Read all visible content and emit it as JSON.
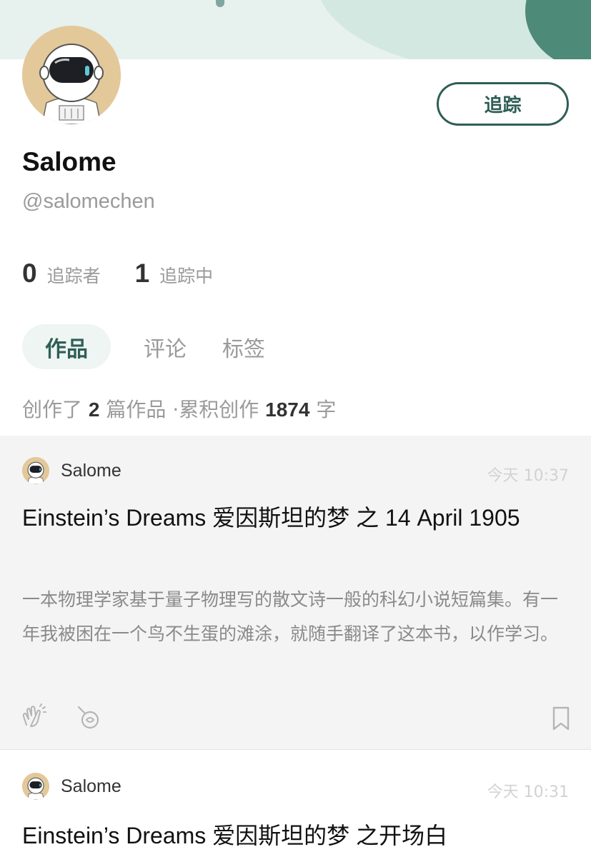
{
  "profile": {
    "follow_label": "追踪",
    "name": "Salome",
    "handle": "@salomechen",
    "followers_count": "0",
    "followers_label": "追踪者",
    "following_count": "1",
    "following_label": "追踪中",
    "avatar_icon": "astronaut-avatar"
  },
  "tabs": [
    {
      "label": "作品",
      "active": true
    },
    {
      "label": "评论",
      "active": false
    },
    {
      "label": "标签",
      "active": false
    }
  ],
  "summary": {
    "prefix": "创作了",
    "works_count": "2",
    "works_unit": "篇作品",
    "separator": "·",
    "total_label": "累积创作",
    "chars_count": "1874",
    "chars_unit": "字"
  },
  "posts": [
    {
      "author": "Salome",
      "time": "今天 10:37",
      "title": "Einstein’s Dreams 爱因斯坦的梦 之 14 April 1905",
      "excerpt": "一本物理学家基于量子物理写的散文诗一般的科幻小说短篇集。有一年我被困在一个鸟不生蛋的滩涂，就随手翻译了这本书，以作学习。",
      "icons": [
        "clap-icon",
        "comment-icon",
        "bookmark-icon"
      ]
    },
    {
      "author": "Salome",
      "time": "今天 10:31",
      "title": "Einstein’s Dreams 爱因斯坦的梦 之开场白"
    }
  ],
  "colors": {
    "accent": "#2f5e56",
    "banner": "#e7f1ee",
    "avatar_bg": "#e3c89a",
    "muted": "#9a9a9a"
  }
}
